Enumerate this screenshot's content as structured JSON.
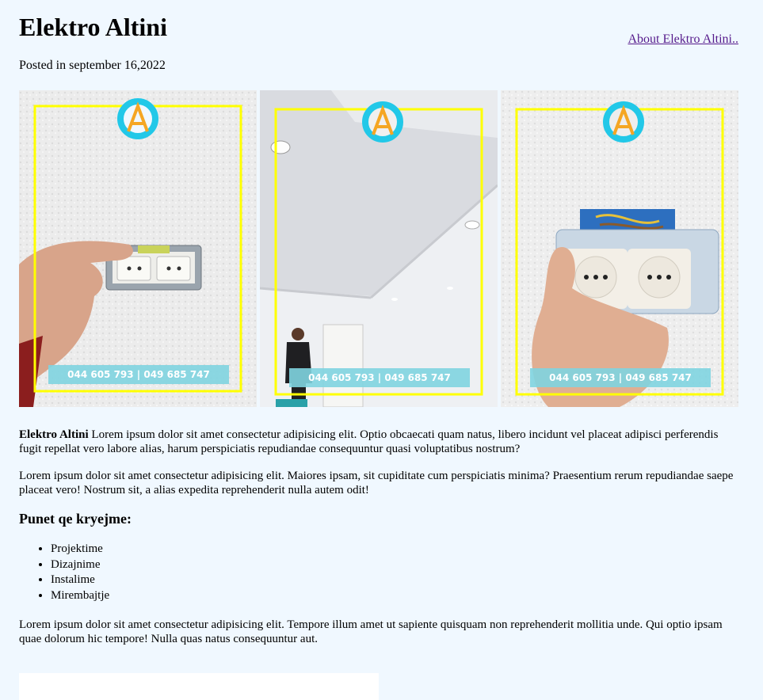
{
  "header": {
    "title": "Elektro Altini",
    "about_link": "About Elektro Altini..",
    "posted": "Posted in september 16,2022"
  },
  "gallery": {
    "phone_text": "044 605 793 | 049 685 747",
    "frame_color": "#ffff00",
    "logo_color": "#22c8e8",
    "images": [
      {
        "subject": "hand leveling wall socket"
      },
      {
        "subject": "room with ceiling lights"
      },
      {
        "subject": "hand holding double socket"
      }
    ]
  },
  "article": {
    "intro_bold": "Elektro Altini",
    "intro_text": " Lorem ipsum dolor sit amet consectetur adipisicing elit. Optio obcaecati quam natus, libero incidunt vel placeat adipisci perferendis fugit repellat vero labore alias, harum perspiciatis repudiandae consequuntur quasi voluptatibus nostrum?",
    "paragraph2": "Lorem ipsum dolor sit amet consectetur adipisicing elit. Maiores ipsam, sit cupiditate cum perspiciatis minima? Praesentium rerum repudiandae saepe placeat vero! Nostrum sit, a alias expedita reprehenderit nulla autem odit!",
    "services_heading": "Punet qe kryejme:",
    "services": [
      "Projektime",
      "Dizajnime",
      "Instalime",
      "Mirembajtje"
    ],
    "paragraph3": "Lorem ipsum dolor sit amet consectetur adipisicing elit. Tempore illum amet ut sapiente quisquam non reprehenderit mollitia unde. Qui optio ipsam quae dolorum hic tempore! Nulla quas natus consequuntur aut."
  }
}
